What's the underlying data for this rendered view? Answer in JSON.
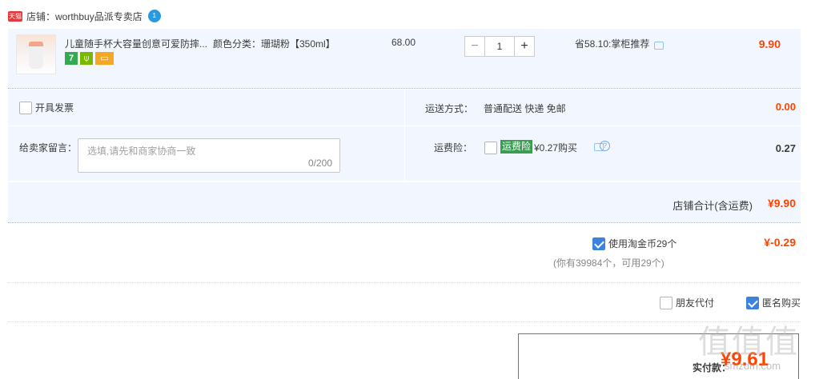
{
  "store": {
    "badge": "天猫",
    "label": "店铺：worthbuy品派专卖店",
    "ww_badge": "1"
  },
  "item": {
    "title": "儿童随手杯大容量创意可爱防摔...",
    "sku": "颜色分类：珊瑚粉【350ml】",
    "badges": [
      "7",
      "⍦",
      "▭"
    ],
    "unit_price": "68.00",
    "quantity": "1",
    "minus": "−",
    "plus": "+",
    "promo": "省58.10:掌柜推荐",
    "total": "9.90"
  },
  "invoice": {
    "label": "开具发票"
  },
  "shipping": {
    "label": "运送方式：",
    "value": "普通配送 快递 免邮",
    "fee": "0.00"
  },
  "message": {
    "label": "给卖家留言：",
    "placeholder": "选填,请先和商家协商一致",
    "count": "0/200"
  },
  "insurance": {
    "label": "运费险：",
    "tag": "运费险",
    "text": "¥0.27购买",
    "help": "?",
    "value": "0.27"
  },
  "store_total": {
    "label": "店铺合计(含运费)",
    "value": "¥9.90"
  },
  "coins": {
    "label": "使用淘金币29个",
    "value": "¥-0.29",
    "note": "(你有39984个，可用29个)"
  },
  "options": {
    "friend_pay": "朋友代付",
    "anonymous": "匿名购买"
  },
  "payment": {
    "label": "实付款：",
    "value": "¥9.61"
  },
  "watermark": {
    "text": "值值值",
    "url": "smzdm.com"
  },
  "colors": {
    "accent": "#ff4400",
    "panel": "#f2f7ff",
    "checkbox": "#3d83de",
    "insurance_tag": "#3a9e52"
  }
}
